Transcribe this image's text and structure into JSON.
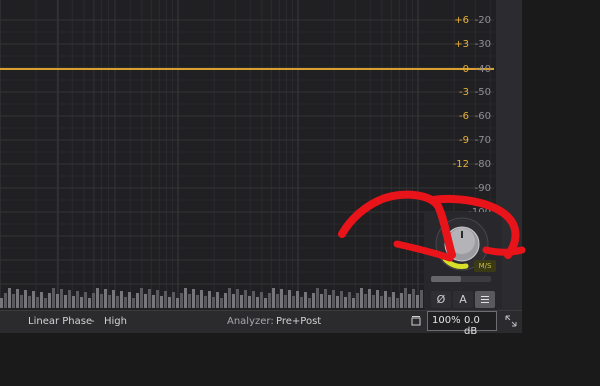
{
  "gain_scale": {
    "labels": [
      "+6",
      "+3",
      "0",
      "-3",
      "-6",
      "-9",
      "-12"
    ],
    "color": "#e8b23a"
  },
  "db_scale": {
    "labels": [
      "-20",
      "-30",
      "-40",
      "-50",
      "-60",
      "-70",
      "-80",
      "-90",
      "-100"
    ],
    "color": "#8f8e93"
  },
  "eq_curve_color": "#d8a030",
  "bottom_bar": {
    "processing_mode": "Linear Phase",
    "separator": "-",
    "quality": "High",
    "analyzer_label": "Analyzer:",
    "analyzer_value": "Pre+Post",
    "zoom": "100%",
    "output_gain": "0.0 dB"
  },
  "control_panel": {
    "ms_badge": "M/S",
    "phase_invert_label": "Ø",
    "auto_gain_label": "A",
    "menu_icon": "menu-lines-icon",
    "knob_accent": "#d8e02a",
    "gain_slider_fill_fraction": 0.5
  },
  "annotation_color": "#e8141a"
}
